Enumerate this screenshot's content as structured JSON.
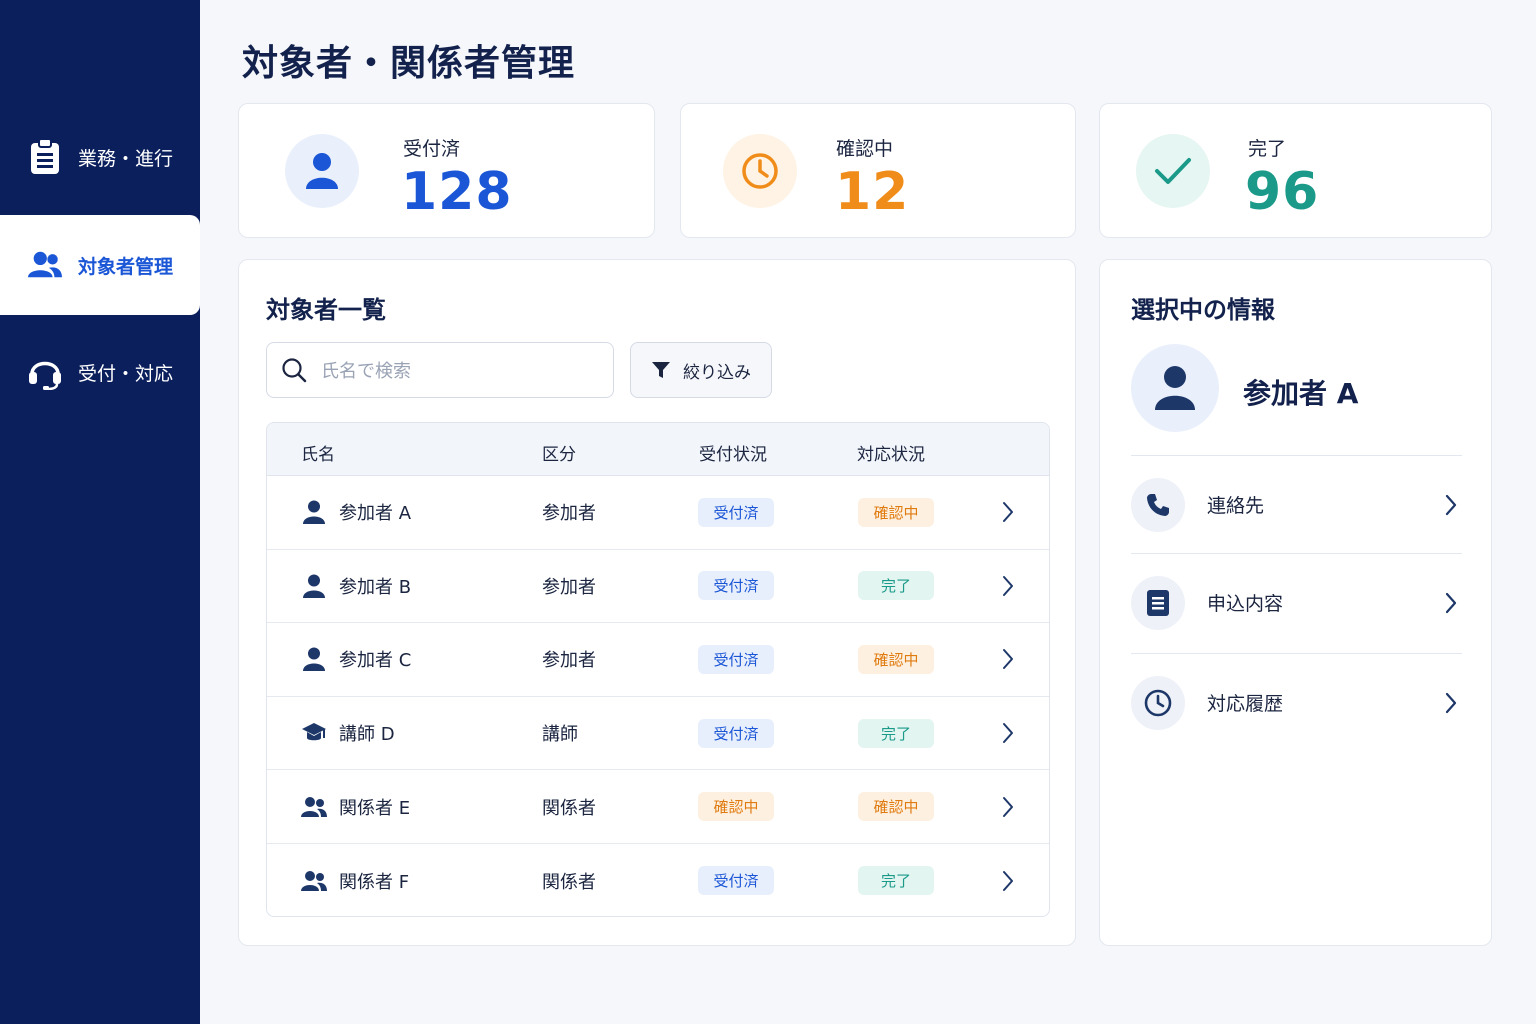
{
  "sidebar": {
    "items": [
      {
        "label": "業務・進行",
        "icon": "clipboard-icon",
        "active": false
      },
      {
        "label": "対象者管理",
        "icon": "users-icon",
        "active": true
      },
      {
        "label": "受付・対応",
        "icon": "headset-icon",
        "active": false
      }
    ]
  },
  "page_title": "対象者・関係者管理",
  "stats": [
    {
      "label": "受付済",
      "value": "128",
      "icon": "user-icon",
      "color": "#1a56d6",
      "bg": "#eaf0fb"
    },
    {
      "label": "確認中",
      "value": "12",
      "icon": "clock-icon",
      "color": "#f08c1a",
      "bg": "#fef3e4"
    },
    {
      "label": "完了",
      "value": "96",
      "icon": "check-icon",
      "color": "#1b9a8a",
      "bg": "#e6f6f2"
    }
  ],
  "list": {
    "title": "対象者一覧",
    "search_placeholder": "氏名で検索",
    "filter_label": "絞り込み",
    "headers": {
      "name": "氏名",
      "category": "区分",
      "reception": "受付状況",
      "response": "対応状況"
    },
    "rows": [
      {
        "name": "参加者 A",
        "icon": "user-icon",
        "category": "参加者",
        "reception": "受付済",
        "response": "確認中"
      },
      {
        "name": "参加者 B",
        "icon": "user-icon",
        "category": "参加者",
        "reception": "受付済",
        "response": "完了"
      },
      {
        "name": "参加者 C",
        "icon": "user-icon",
        "category": "参加者",
        "reception": "受付済",
        "response": "確認中"
      },
      {
        "name": "講師 D",
        "icon": "graduation-cap-icon",
        "category": "講師",
        "reception": "受付済",
        "response": "完了"
      },
      {
        "name": "関係者 E",
        "icon": "users-icon",
        "category": "関係者",
        "reception": "確認中",
        "response": "確認中"
      },
      {
        "name": "関係者 F",
        "icon": "users-icon",
        "category": "関係者",
        "reception": "受付済",
        "response": "完了"
      }
    ]
  },
  "detail": {
    "title": "選択中の情報",
    "selected_name": "参加者 A",
    "items": [
      {
        "label": "連絡先",
        "icon": "phone-icon"
      },
      {
        "label": "申込内容",
        "icon": "document-icon"
      },
      {
        "label": "対応履歴",
        "icon": "clock-icon"
      }
    ]
  },
  "badge_styles": {
    "受付済": {
      "color": "#1a56d6",
      "bg": "#e8effc"
    },
    "確認中": {
      "color": "#e07b10",
      "bg": "#fdf0e0"
    },
    "完了": {
      "color": "#1b9a8a",
      "bg": "#e3f5f0"
    }
  }
}
